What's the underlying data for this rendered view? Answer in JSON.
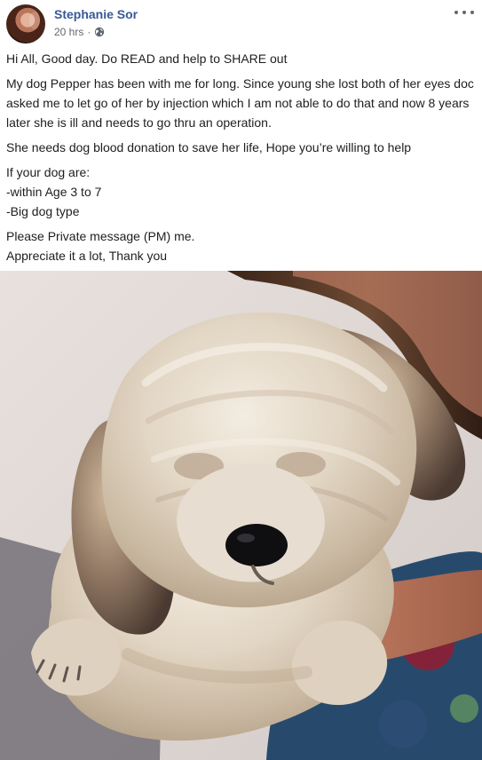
{
  "post": {
    "author": "Stephanie Sor",
    "timestamp": "20 hrs",
    "separator": "·",
    "paragraphs": [
      "Hi All, Good day. Do READ and help to SHARE out",
      "My dog Pepper has been with me for long. Since young she lost both of her eyes doc asked me to let go of her by injection which I am not able to do that and now 8 years later she is ill and needs to go thru an operation.",
      "She needs dog blood donation to save her life, Hope you’re willing to help"
    ],
    "requirements": {
      "intro": "If your dog are:",
      "items": [
        "-within Age 3 to 7",
        "-Big dog type"
      ]
    },
    "closing": [
      "Please Private message (PM) me.",
      "Appreciate it a lot, Thank you"
    ]
  },
  "icons": {
    "visibility": "globe-icon",
    "menu": "more-options-icon"
  },
  "colors": {
    "author_link": "#385898",
    "meta_text": "#606770",
    "body_text": "#1c1e21"
  }
}
